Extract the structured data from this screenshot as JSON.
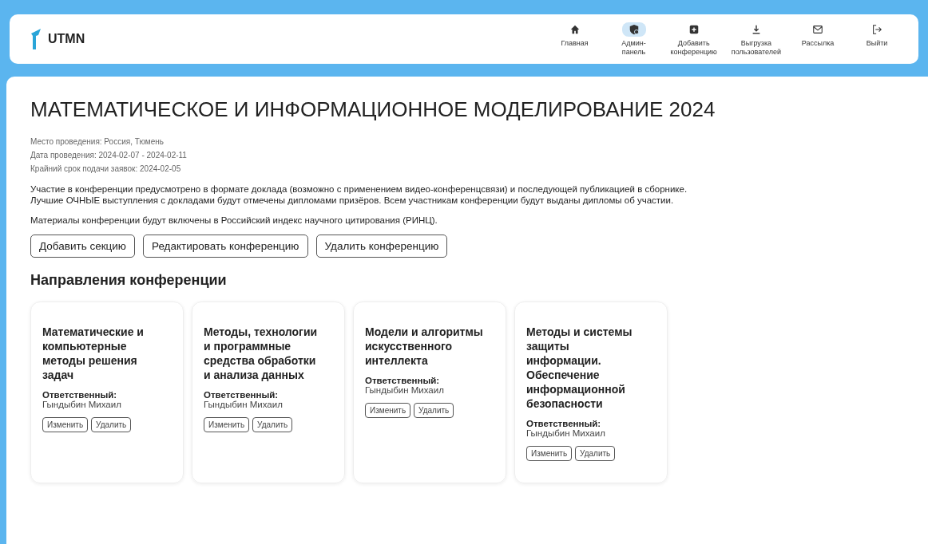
{
  "header": {
    "logo": "UTMN",
    "nav": [
      {
        "kind": "home",
        "label": "Главная",
        "selected": false
      },
      {
        "kind": "admin",
        "label": "Админ-панель",
        "selected": true
      },
      {
        "kind": "add",
        "label": "Добавить конференцию",
        "selected": false
      },
      {
        "kind": "download",
        "label": "Выгрузка пользователей",
        "selected": false
      },
      {
        "kind": "mail",
        "label": "Рассылка",
        "selected": false
      },
      {
        "kind": "logout",
        "label": "Выйти",
        "selected": false
      }
    ]
  },
  "conference": {
    "title": "МАТЕМАТИЧЕСКОЕ И ИНФОРМАЦИОННОЕ МОДЕЛИРОВАНИЕ 2024",
    "meta": [
      "Место проведения: Россия, Тюмень",
      "Дата проведения: 2024-02-07 - 2024-02-11",
      "Крайний срок подачи заявок: 2024-02-05"
    ],
    "description": [
      "Участие в конференции предусмотрено в формате доклада (возможно с применением видео-конференцсвязи) и последующей публикацией в сборнике.",
      "Лучшие ОЧНЫЕ выступления с докладами будут отмечены дипломами призёров. Всем участникам конференции будут выданы дипломы об участии."
    ],
    "note": "Материалы конференции будут включены в Российский индекс научного цитирования (РИНЦ).",
    "actions": [
      "Добавить секцию",
      "Редактировать конференцию",
      "Удалить конференцию"
    ]
  },
  "sections_heading": "Направления конференции",
  "sections": [
    {
      "title": "Математические и компьютерные методы решения задач",
      "responsible_label": "Ответственный:",
      "responsible": "Гындыбин Михаил",
      "buttons": [
        "Изменить",
        "Удалить"
      ]
    },
    {
      "title": "Методы, технологии и программные средства обработки и анализа данных",
      "responsible_label": "Ответственный:",
      "responsible": "Гындыбин Михаил",
      "buttons": [
        "Изменить",
        "Удалить"
      ]
    },
    {
      "title": "Модели и алгоритмы искусственного интеллекта",
      "responsible_label": "Ответственный:",
      "responsible": "Гындыбин Михаил",
      "buttons": [
        "Изменить",
        "Удалить"
      ]
    },
    {
      "title": "Методы и системы защиты информации. Обеспечение информационной безопасности",
      "responsible_label": "Ответственный:",
      "responsible": "Гындыбин Михаил",
      "buttons": [
        "Изменить",
        "Удалить"
      ]
    }
  ]
}
